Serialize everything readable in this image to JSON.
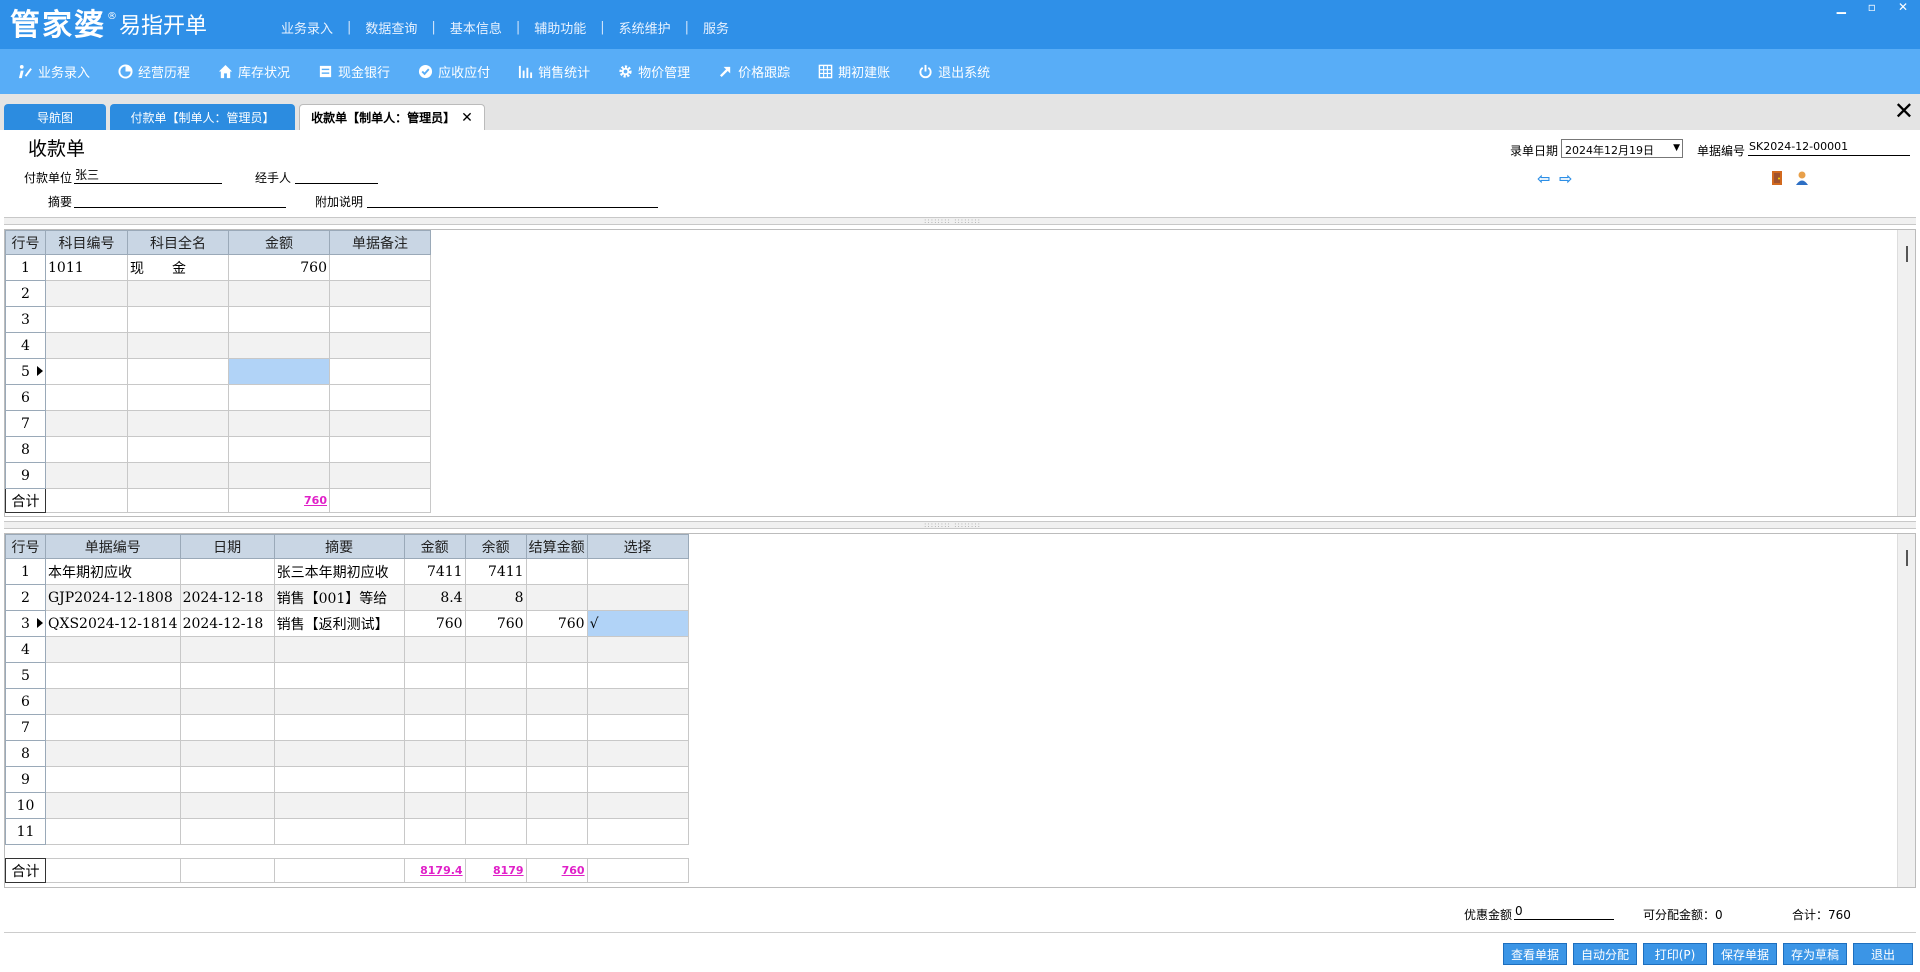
{
  "app": {
    "logo_main": "管家婆",
    "logo_reg": "®",
    "logo_sub": "易指开单",
    "top_menu": [
      "业务录入",
      "数据查询",
      "基本信息",
      "辅助功能",
      "系统维护",
      "服务"
    ]
  },
  "toolbar": {
    "items": [
      {
        "label": "业务录入",
        "icon": "pen-icon"
      },
      {
        "label": "经营历程",
        "icon": "pie-chart-icon"
      },
      {
        "label": "库存状况",
        "icon": "house-icon"
      },
      {
        "label": "现金银行",
        "icon": "card-icon"
      },
      {
        "label": "应收应付",
        "icon": "check-circle-icon"
      },
      {
        "label": "销售统计",
        "icon": "bar-chart-icon"
      },
      {
        "label": "物价管理",
        "icon": "gear-icon"
      },
      {
        "label": "价格跟踪",
        "icon": "arrow-up-right-icon"
      },
      {
        "label": "期初建账",
        "icon": "grid-icon"
      },
      {
        "label": "退出系统",
        "icon": "power-icon"
      }
    ]
  },
  "tabs": {
    "nav": "导航图",
    "payment": "付款单【制单人：管理员】",
    "receipt": "收款单【制单人：管理员】",
    "close_glyph": "✕",
    "window_close": "✕"
  },
  "form": {
    "title": "收款单",
    "payer_label": "付款单位",
    "payer_value": "张三",
    "handler_label": "经手人",
    "handler_value": "",
    "summary_label": "摘要",
    "summary_value": "",
    "note_label": "附加说明",
    "note_value": "",
    "date_label": "录单日期",
    "date_value": "2024年12月19日",
    "docno_label": "单据编号",
    "docno_value": "SK2024-12-00001"
  },
  "grid1": {
    "headers": [
      "行号",
      "科目编号",
      "科目全名",
      "金额",
      "单据备注"
    ],
    "rows": [
      {
        "no": "1",
        "code": "1011",
        "name": "现　　金",
        "amount": "760",
        "note": ""
      },
      {
        "no": "2",
        "code": "",
        "name": "",
        "amount": "",
        "note": ""
      },
      {
        "no": "3",
        "code": "",
        "name": "",
        "amount": "",
        "note": ""
      },
      {
        "no": "4",
        "code": "",
        "name": "",
        "amount": "",
        "note": ""
      },
      {
        "no": "5",
        "code": "",
        "name": "",
        "amount": "",
        "note": ""
      },
      {
        "no": "6",
        "code": "",
        "name": "",
        "amount": "",
        "note": ""
      },
      {
        "no": "7",
        "code": "",
        "name": "",
        "amount": "",
        "note": ""
      },
      {
        "no": "8",
        "code": "",
        "name": "",
        "amount": "",
        "note": ""
      },
      {
        "no": "9",
        "code": "",
        "name": "",
        "amount": "",
        "note": ""
      }
    ],
    "total_label": "合计",
    "total_amount": "760"
  },
  "grid2": {
    "headers": [
      "行号",
      "单据编号",
      "日期",
      "摘要",
      "金额",
      "余额",
      "结算金额",
      "选择"
    ],
    "rows": [
      {
        "no": "1",
        "docno": "本年期初应收",
        "date": "",
        "summary": "张三本年期初应收",
        "amount": "7411",
        "balance": "7411",
        "settle": "",
        "pick": ""
      },
      {
        "no": "2",
        "docno": "GJP2024-12-1808",
        "date": "2024-12-18",
        "summary": "销售【001】等给",
        "amount": "8.4",
        "balance": "8",
        "settle": "",
        "pick": ""
      },
      {
        "no": "3",
        "docno": "QXS2024-12-1814",
        "date": "2024-12-18",
        "summary": "销售【返利测试】",
        "amount": "760",
        "balance": "760",
        "settle": "760",
        "pick": "√"
      },
      {
        "no": "4",
        "docno": "",
        "date": "",
        "summary": "",
        "amount": "",
        "balance": "",
        "settle": "",
        "pick": ""
      },
      {
        "no": "5",
        "docno": "",
        "date": "",
        "summary": "",
        "amount": "",
        "balance": "",
        "settle": "",
        "pick": ""
      },
      {
        "no": "6",
        "docno": "",
        "date": "",
        "summary": "",
        "amount": "",
        "balance": "",
        "settle": "",
        "pick": ""
      },
      {
        "no": "7",
        "docno": "",
        "date": "",
        "summary": "",
        "amount": "",
        "balance": "",
        "settle": "",
        "pick": ""
      },
      {
        "no": "8",
        "docno": "",
        "date": "",
        "summary": "",
        "amount": "",
        "balance": "",
        "settle": "",
        "pick": ""
      },
      {
        "no": "9",
        "docno": "",
        "date": "",
        "summary": "",
        "amount": "",
        "balance": "",
        "settle": "",
        "pick": ""
      },
      {
        "no": "10",
        "docno": "",
        "date": "",
        "summary": "",
        "amount": "",
        "balance": "",
        "settle": "",
        "pick": ""
      },
      {
        "no": "11",
        "docno": "",
        "date": "",
        "summary": "",
        "amount": "",
        "balance": "",
        "settle": "",
        "pick": ""
      }
    ],
    "total_label": "合计",
    "total_amount": "8179.4",
    "total_balance": "8179",
    "total_settle": "760"
  },
  "summary": {
    "discount_label": "优惠金额",
    "discount_value": "0",
    "allocatable_label": "可分配金额：0",
    "total_label": "合计：760"
  },
  "buttons": {
    "view": "查看单据",
    "auto": "自动分配",
    "print": "打印(P)",
    "save": "保存单据",
    "draft": "存为草稿",
    "exit": "退出"
  }
}
